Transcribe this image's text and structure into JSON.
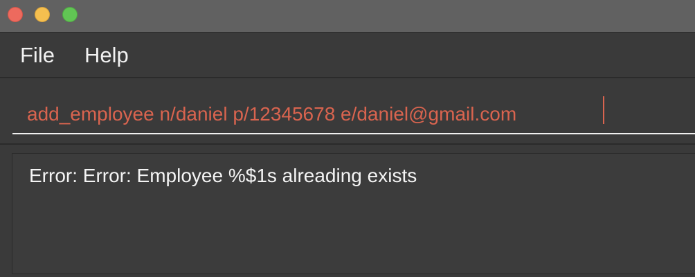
{
  "window": {
    "controls": {
      "close": {
        "icon": "close-traffic-light-icon",
        "color": "#ed6a5e"
      },
      "minimize": {
        "icon": "minimize-traffic-light-icon",
        "color": "#f5bf4f"
      },
      "maximize": {
        "icon": "maximize-traffic-light-icon",
        "color": "#61c554"
      }
    }
  },
  "menubar": {
    "items": [
      {
        "label": "File"
      },
      {
        "label": "Help"
      }
    ]
  },
  "command": {
    "value": "add_employee n/daniel p/12345678 e/daniel@gmail.com",
    "text_color": "#d9644f"
  },
  "result": {
    "message": "Error: Error: Employee %$1s alreading exists"
  },
  "colors": {
    "background": "#3a3a3a",
    "titlebar": "#616161",
    "text": "#f2f2f2",
    "accent": "#d9644f"
  }
}
